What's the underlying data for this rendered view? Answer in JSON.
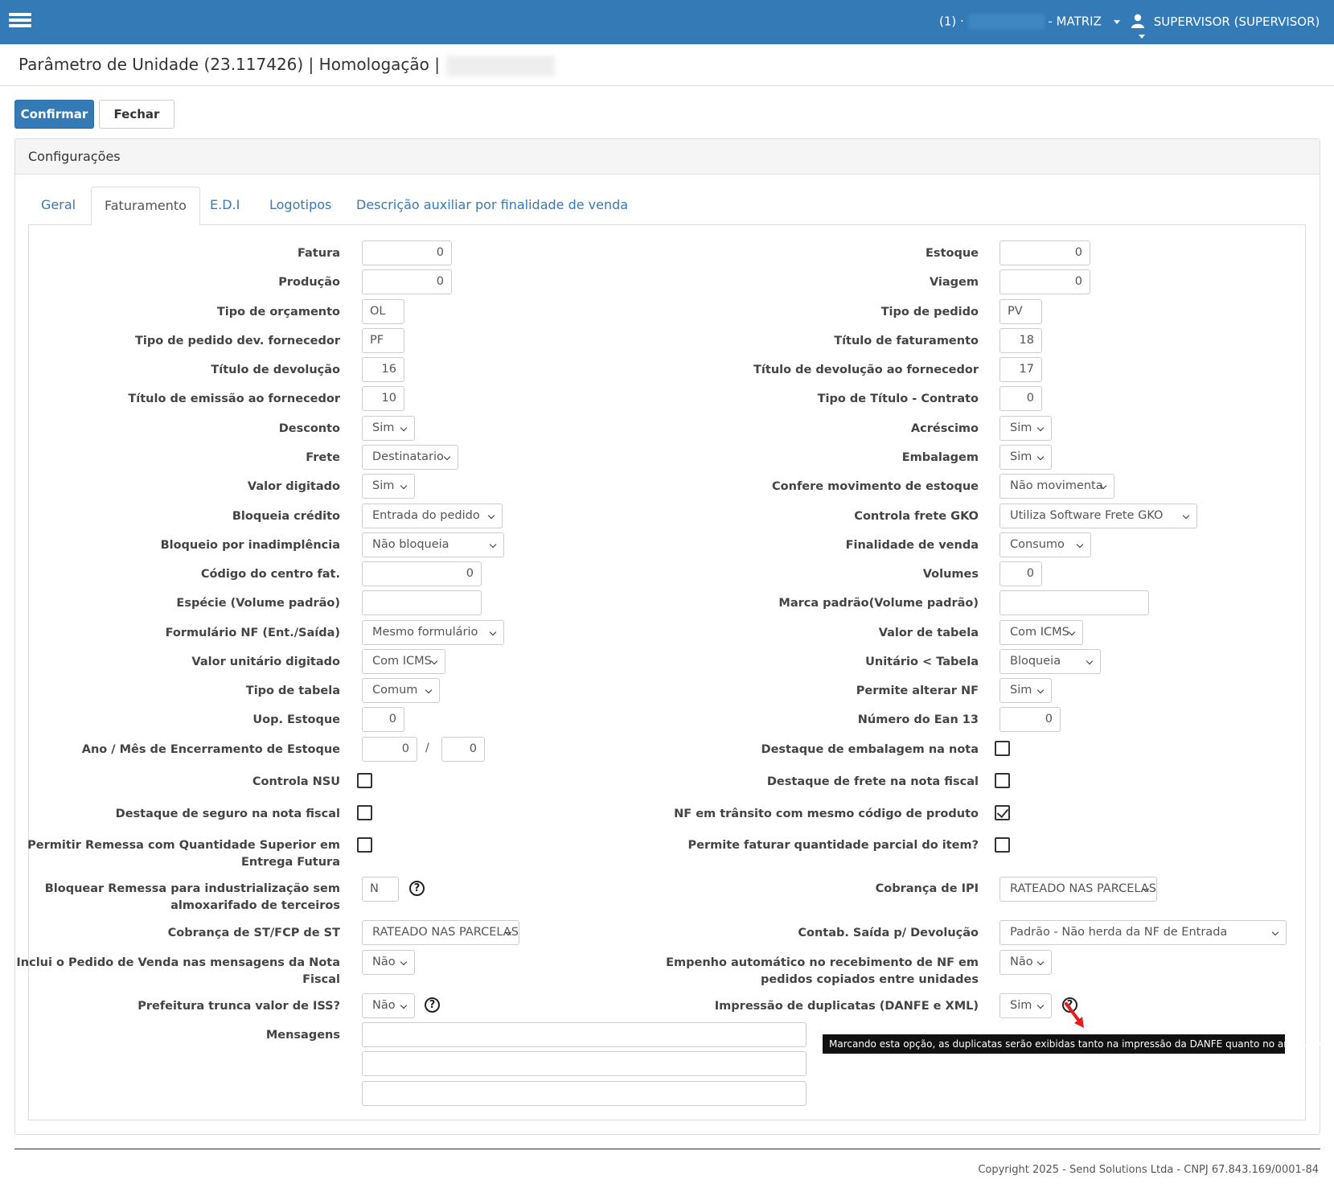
{
  "nav": {
    "unit_prefix": "(1) ·",
    "unit_label": "- MATRIZ",
    "user_label": "SUPERVISOR (SUPERVISOR)"
  },
  "header": {
    "title": "Parâmetro de Unidade (23.117426) | Homologação |"
  },
  "buttons": {
    "confirm": "Confirmar",
    "close": "Fechar"
  },
  "panel": {
    "title": "Configurações"
  },
  "tabs": [
    "Geral",
    "Faturamento",
    "E.D.I",
    "Logotipos",
    "Descrição auxiliar por finalidade de venda"
  ],
  "left": {
    "fatura": {
      "label": "Fatura",
      "value": "0"
    },
    "producao": {
      "label": "Produção",
      "value": "0"
    },
    "tipo_orcamento": {
      "label": "Tipo de orçamento",
      "value": "OL"
    },
    "tipo_pedido_dev": {
      "label": "Tipo de pedido dev. fornecedor",
      "value": "PF"
    },
    "titulo_devolucao": {
      "label": "Título de devolução",
      "value": "16"
    },
    "titulo_emissao": {
      "label": "Título de emissão ao fornecedor",
      "value": "10"
    },
    "desconto": {
      "label": "Desconto",
      "value": "Sim"
    },
    "frete": {
      "label": "Frete",
      "value": "Destinatario"
    },
    "valor_digitado": {
      "label": "Valor digitado",
      "value": "Sim"
    },
    "bloqueia_credito": {
      "label": "Bloqueia crédito",
      "value": "Entrada do pedido"
    },
    "bloqueio_inad": {
      "label": "Bloqueio por inadimplência",
      "value": "Não bloqueia"
    },
    "codigo_centro": {
      "label": "Código do centro fat.",
      "value": "0"
    },
    "especie": {
      "label": "Espécie (Volume padrão)",
      "value": ""
    },
    "formulario_nf": {
      "label": "Formulário NF (Ent./Saída)",
      "value": "Mesmo formulário"
    },
    "valor_unitario": {
      "label": "Valor unitário digitado",
      "value": "Com ICMS"
    },
    "tipo_tabela": {
      "label": "Tipo de tabela",
      "value": "Comum"
    },
    "uop_estoque": {
      "label": "Uop. Estoque",
      "value": "0"
    },
    "ano_mes": {
      "label": "Ano / Mês de Encerramento de Estoque",
      "ano": "0",
      "sep": "/",
      "mes": "0"
    },
    "controla_nsu": {
      "label": "Controla NSU"
    },
    "destaque_seguro": {
      "label": "Destaque de seguro na nota fiscal"
    },
    "permitir_remessa": {
      "label1": "Permitir Remessa com Quantidade Superior em",
      "label2": "Entrega Futura"
    },
    "bloquear_remessa": {
      "label1": "Bloquear Remessa para industrialização sem",
      "label2": "almoxarifado de terceiros",
      "value": "N"
    },
    "cobranca_st": {
      "label": "Cobrança de ST/FCP de ST",
      "value": "RATEADO NAS PARCELAS"
    },
    "inclui_pedido": {
      "label": "Inclui o Pedido de Venda nas mensagens da Nota Fiscal",
      "value": "Não"
    },
    "prefeitura_iss": {
      "label": "Prefeitura trunca valor de ISS?",
      "value": "Não"
    },
    "mensagens": {
      "label": "Mensagens"
    }
  },
  "right": {
    "estoque": {
      "label": "Estoque",
      "value": "0"
    },
    "viagem": {
      "label": "Viagem",
      "value": "0"
    },
    "tipo_pedido": {
      "label": "Tipo de pedido",
      "value": "PV"
    },
    "titulo_faturamento": {
      "label": "Título de faturamento",
      "value": "18"
    },
    "titulo_dev_forn": {
      "label": "Título de devolução ao fornecedor",
      "value": "17"
    },
    "tipo_titulo_contrato": {
      "label": "Tipo de Título - Contrato",
      "value": "0"
    },
    "acrescimo": {
      "label": "Acréscimo",
      "value": "Sim"
    },
    "embalagem": {
      "label": "Embalagem",
      "value": "Sim"
    },
    "confere_mov": {
      "label": "Confere movimento de estoque",
      "value": "Não movimenta"
    },
    "controla_gko": {
      "label": "Controla frete GKO",
      "value": "Utiliza Software Frete GKO"
    },
    "finalidade_venda": {
      "label": "Finalidade de venda",
      "value": "Consumo"
    },
    "volumes": {
      "label": "Volumes",
      "value": "0"
    },
    "marca_padrao": {
      "label": "Marca padrão(Volume padrão)",
      "value": ""
    },
    "valor_tabela": {
      "label": "Valor de tabela",
      "value": "Com ICMS"
    },
    "unitario_tabela": {
      "label": "Unitário < Tabela",
      "value": "Bloqueia"
    },
    "permite_alterar": {
      "label": "Permite alterar NF",
      "value": "Sim"
    },
    "numero_ean": {
      "label": "Número do Ean 13",
      "value": "0"
    },
    "destaque_embalagem": {
      "label": "Destaque de embalagem na nota"
    },
    "destaque_frete": {
      "label": "Destaque de frete na nota fiscal"
    },
    "nf_transito": {
      "label": "NF em trânsito com mesmo código de produto"
    },
    "permite_parcial": {
      "label": "Permite faturar quantidade parcial do item?"
    },
    "cobranca_ipi": {
      "label": "Cobrança de IPI",
      "value": "RATEADO NAS PARCELAS"
    },
    "contab_saida": {
      "label": "Contab. Saída p/ Devolução",
      "value": "Padrão - Não herda da NF de Entrada"
    },
    "empenho": {
      "label1": "Empenho automático no recebimento de NF em",
      "label2": "pedidos copiados entre unidades",
      "value": "Não"
    },
    "impressao_dup": {
      "label": "Impressão de duplicatas (DANFE e XML)",
      "value": "Sim"
    }
  },
  "help_glyph": "?",
  "tooltip": "Marcando esta opção, as duplicatas serão exibidas tanto na impressão da DANFE quanto no arquivo XML.",
  "footer": "Copyright 2025 - Send Solutions Ltda - CNPJ 67.843.169/0001-84",
  "colors": {
    "navbar": "#337ab7",
    "primary": "#337ab7",
    "link": "#337ab7"
  }
}
